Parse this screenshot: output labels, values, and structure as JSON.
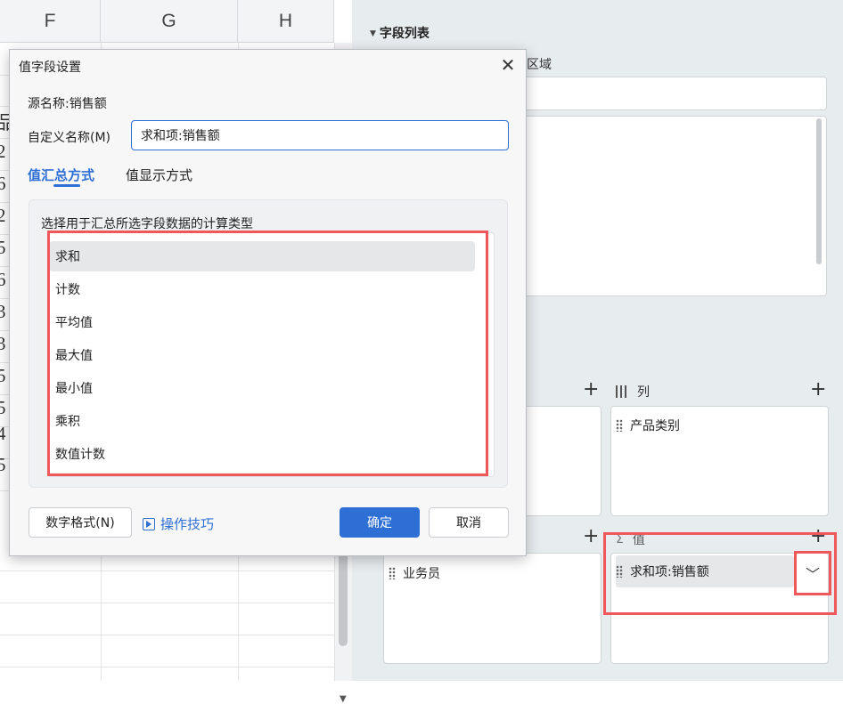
{
  "sheet": {
    "columns": [
      "F",
      "G",
      "H"
    ],
    "row_fragments": [
      "品",
      "2",
      "6",
      "2",
      "5",
      "6",
      "3",
      "3",
      "5",
      "5",
      "4",
      "5"
    ]
  },
  "pane": {
    "title": "字段列表",
    "filter_area_label": "筛选区域",
    "columns_label": "列",
    "values_label": "值",
    "column_chip": "产品类别",
    "row_chip": "业务员",
    "value_chip": "求和项:销售额"
  },
  "dialog": {
    "title": "值字段设置",
    "source_name": "源名称:销售额",
    "custom_name_label": "自定义名称(M)",
    "custom_name_value": "求和项:销售额",
    "tabs": [
      "值汇总方式",
      "值显示方式"
    ],
    "group_label": "选择用于汇总所选字段数据的计算类型",
    "summary_types": [
      "求和",
      "计数",
      "平均值",
      "最大值",
      "最小值",
      "乘积",
      "数值计数"
    ],
    "selected": "求和",
    "buttons": {
      "number_format": "数字格式(N)",
      "tips": "操作技巧",
      "ok": "确定",
      "cancel": "取消"
    }
  },
  "colors": {
    "accent": "#2e6fd6",
    "highlight_red": "#f0575a"
  }
}
